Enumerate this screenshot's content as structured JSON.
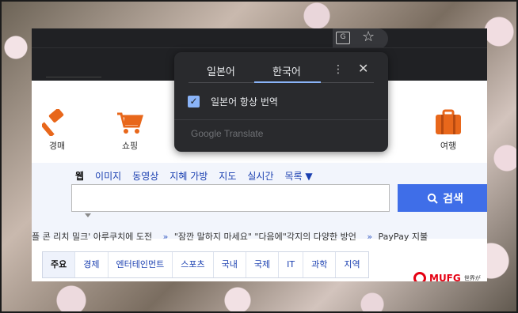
{
  "services": [
    {
      "label": "경매",
      "icon": "auction-gavel-icon"
    },
    {
      "label": "쇼핑",
      "icon": "shopping-cart-icon"
    },
    {
      "label": "여행",
      "icon": "travel-suitcase-icon"
    }
  ],
  "search": {
    "tabs": [
      "웹",
      "이미지",
      "동영상",
      "지혜 가방",
      "지도",
      "실시간",
      "목록 ▼"
    ],
    "button_label": "검색",
    "input_value": ""
  },
  "ticker": {
    "items": [
      "플 콘 리치 밀크' 아루쿠치에 도전",
      "\"잠깐 말하지 마세요\" \"다음에\"각지의 다양한 방언",
      "PayPay 지불"
    ],
    "separator": "»"
  },
  "news_tabs": [
    "주요",
    "경제",
    "엔터테인먼트",
    "스포츠",
    "국내",
    "국제",
    "IT",
    "과학",
    "지역"
  ],
  "ad": {
    "brand": "MUFG",
    "small_text": "世界が"
  },
  "translate_popup": {
    "tab_source": "일본어",
    "tab_target": "한국어",
    "checkbox_label": "일본어 항상 번역",
    "checkbox_checked": true,
    "footer": "Google Translate"
  },
  "colors": {
    "accent": "#8ab4f8",
    "search_button": "#3f6ee8",
    "popup_bg": "#292a2d"
  }
}
